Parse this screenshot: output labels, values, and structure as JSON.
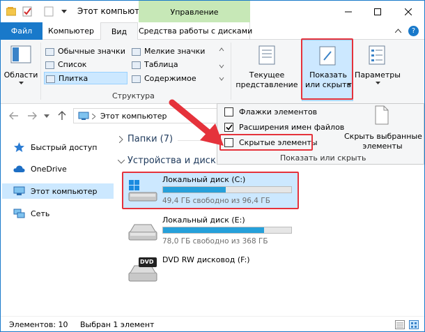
{
  "window": {
    "title": "Этот компьют",
    "manage_tab": "Управление",
    "accent_color": "#1979ca",
    "manage_color": "#c7e8b7",
    "highlight_color": "#e5323b"
  },
  "tabs": {
    "file": "Файл",
    "computer": "Компьютер",
    "view": "Вид",
    "disk_tools": "Средства работы с дисками"
  },
  "ribbon": {
    "areas_label": "Области",
    "layout": {
      "items": [
        "Обычные значки",
        "Мелкие значки",
        "Список",
        "Таблица",
        "Плитка",
        "Содержимое"
      ],
      "selected": "Плитка",
      "group_label": "Структура"
    },
    "current_view": {
      "line1": "Текущее",
      "line2": "представление"
    },
    "show_hide": {
      "line1": "Показать",
      "line2": "или скрыть"
    },
    "options_label": "Параметры"
  },
  "show_hide_menu": {
    "item_checkboxes": "Флажки элементов",
    "item_checkboxes_checked": false,
    "item_extensions": "Расширения имен файлов",
    "item_extensions_checked": true,
    "item_hidden": "Скрытые элементы",
    "item_hidden_checked": false,
    "hide_selected_line1": "Скрыть выбранные",
    "hide_selected_line2": "элементы",
    "group_label": "Показать или скрыть"
  },
  "address": {
    "path": "Этот компьютер"
  },
  "sidebar": {
    "quick_access": "Быстрый доступ",
    "onedrive": "OneDrive",
    "this_pc": "Этот компьютер",
    "network": "Сеть"
  },
  "content": {
    "folders_header": "Папки (7)",
    "devices_header": "Устройства и диск",
    "drives": [
      {
        "name": "Локальный диск (C:)",
        "free": "49,4 ГБ свободно из 96,4 ГБ",
        "used_fraction": 0.49
      },
      {
        "name": "Локальный диск (E:)",
        "free": "78,0 ГБ свободно из 368 ГБ",
        "used_fraction": 0.79
      },
      {
        "name": "DVD RW дисковод (F:)",
        "icon_text": "DVD"
      }
    ]
  },
  "status": {
    "items": "Элементов: 10",
    "selected": "Выбран 1 элемент"
  }
}
